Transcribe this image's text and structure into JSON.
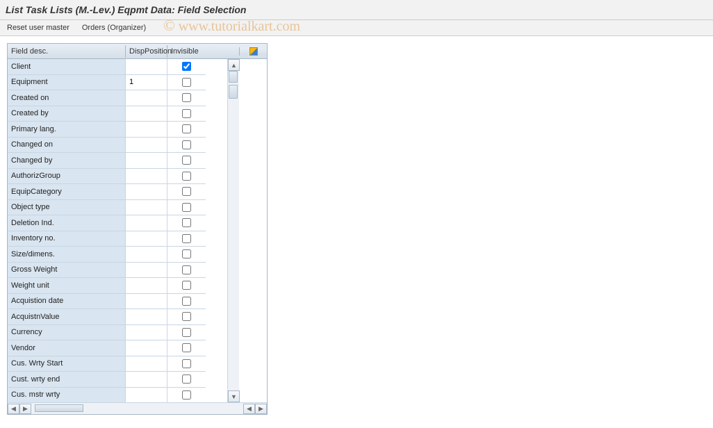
{
  "header": {
    "title": "List Task Lists (M.-Lev.) Eqpmt Data: Field Selection"
  },
  "toolbar": {
    "reset_label": "Reset user master",
    "orders_label": "Orders (Organizer)"
  },
  "table": {
    "columns": {
      "desc": "Field desc.",
      "pos": "DispPosition",
      "inv": "Invisible"
    },
    "rows": [
      {
        "desc": "Client",
        "pos": "",
        "inv": true
      },
      {
        "desc": "Equipment",
        "pos": "1",
        "inv": false
      },
      {
        "desc": "Created on",
        "pos": "",
        "inv": false
      },
      {
        "desc": "Created by",
        "pos": "",
        "inv": false
      },
      {
        "desc": "Primary lang.",
        "pos": "",
        "inv": false
      },
      {
        "desc": "Changed on",
        "pos": "",
        "inv": false
      },
      {
        "desc": "Changed by",
        "pos": "",
        "inv": false
      },
      {
        "desc": "AuthorizGroup",
        "pos": "",
        "inv": false
      },
      {
        "desc": "EquipCategory",
        "pos": "",
        "inv": false
      },
      {
        "desc": "Object type",
        "pos": "",
        "inv": false
      },
      {
        "desc": "Deletion Ind.",
        "pos": "",
        "inv": false
      },
      {
        "desc": "Inventory no.",
        "pos": "",
        "inv": false
      },
      {
        "desc": "Size/dimens.",
        "pos": "",
        "inv": false
      },
      {
        "desc": "Gross Weight",
        "pos": "",
        "inv": false
      },
      {
        "desc": "Weight unit",
        "pos": "",
        "inv": false
      },
      {
        "desc": "Acquistion date",
        "pos": "",
        "inv": false
      },
      {
        "desc": "AcquistnValue",
        "pos": "",
        "inv": false
      },
      {
        "desc": "Currency",
        "pos": "",
        "inv": false
      },
      {
        "desc": "Vendor",
        "pos": "",
        "inv": false
      },
      {
        "desc": "Cus. Wrty Start",
        "pos": "",
        "inv": false
      },
      {
        "desc": "Cust. wrty end",
        "pos": "",
        "inv": false
      },
      {
        "desc": "Cus. mstr wrty",
        "pos": "",
        "inv": false
      }
    ]
  },
  "watermark": {
    "copy": "©",
    "text": "www.tutorialkart.com"
  }
}
